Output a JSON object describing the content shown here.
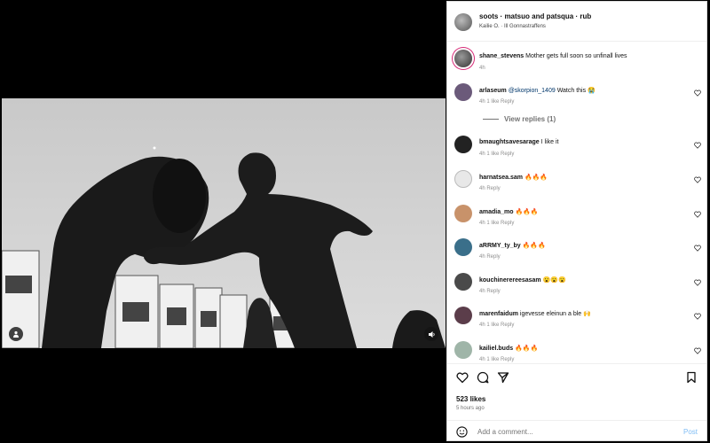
{
  "post": {
    "header_name": "soots · matsuo and patsqua · rub",
    "header_sub": "Kailie O. · Ill Gonnastraffens",
    "caption_user": "shane_stevens",
    "caption_text": "Mother gets full soon so unfinall lives",
    "caption_meta": "4h"
  },
  "comments": [
    {
      "user": "arlaseum",
      "mention": "@skorpion_1409",
      "text": "Watch this 😭",
      "meta": "4h   1 like   Reply"
    },
    {
      "user": "bmaughtsavesarage",
      "mention": "",
      "text": "I like it",
      "meta": "4h   1 like   Reply"
    },
    {
      "user": "harnatsea.sam",
      "mention": "",
      "text": "🔥🔥🔥",
      "meta": "4h   Reply"
    },
    {
      "user": "amadia_mo",
      "mention": "",
      "text": "🔥🔥🔥",
      "meta": "4h   1 like   Reply"
    },
    {
      "user": "aRRMY_ty_by",
      "mention": "",
      "text": "🔥🔥🔥",
      "meta": "4h   Reply"
    },
    {
      "user": "kouchinerereesasam",
      "mention": "",
      "text": "😮😮😮",
      "meta": "4h   Reply"
    },
    {
      "user": "marenfaidum",
      "mention": "",
      "text": "igevesse eleinun a ble 🙌",
      "meta": "4h   1 like   Reply"
    },
    {
      "user": "kailiel.buds",
      "mention": "",
      "text": "🔥🔥🔥",
      "meta": "4h   1 like   Reply"
    }
  ],
  "view_replies_label": "View replies (1)",
  "likes_label": "523 likes",
  "time_label": "5 hours ago",
  "add_comment_placeholder": "Add a comment...",
  "post_button_label": "Post",
  "icons": {
    "like": "heart-icon",
    "comment": "comment-icon",
    "share": "share-icon",
    "save": "bookmark-icon",
    "emoji": "emoji-icon",
    "tag": "person-tag-icon",
    "mute": "speaker-icon"
  },
  "colors": {
    "link": "#00376b",
    "post_button": "#7fbdf5",
    "story_ring": "#d62976"
  }
}
